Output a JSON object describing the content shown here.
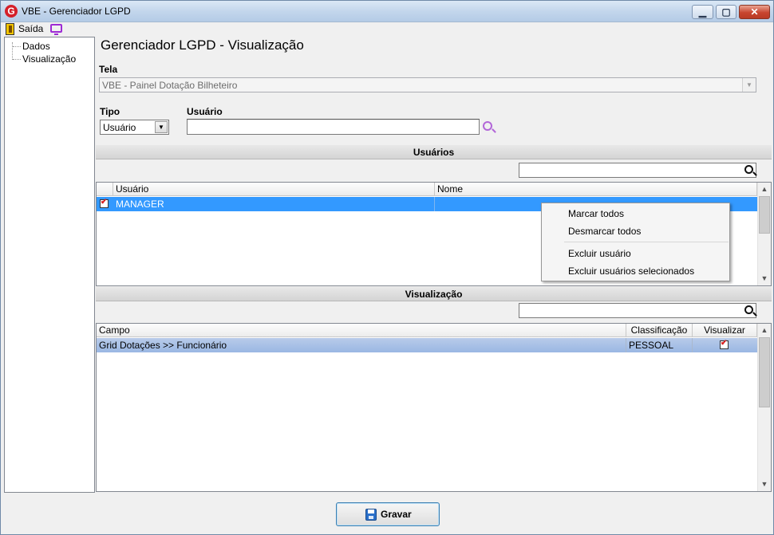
{
  "window": {
    "title": "VBE - Gerenciador LGPD",
    "app_icon": "G",
    "min_glyph": "▁",
    "max_glyph": "▢",
    "close_glyph": "✕"
  },
  "menu": {
    "exit_label": "Saída"
  },
  "tree": {
    "items": [
      {
        "label": "Dados"
      },
      {
        "label": "Visualização"
      }
    ]
  },
  "page": {
    "title": "Gerenciador LGPD - Visualização"
  },
  "form": {
    "tela_label": "Tela",
    "tela_value": "VBE - Painel Dotação Bilheteiro",
    "tipo_label": "Tipo",
    "tipo_value": "Usuário",
    "usuario_label": "Usuário",
    "usuario_value": ""
  },
  "arrows": {
    "down": "▼",
    "up": "▲"
  },
  "users_section": {
    "title": "Usuários",
    "filter_value": "",
    "columns": [
      "Usuário",
      "Nome"
    ],
    "rows": [
      {
        "checked": true,
        "usuario": "MANAGER",
        "nome": ""
      }
    ]
  },
  "context_menu": {
    "items": [
      "Marcar todos",
      "Desmarcar todos",
      "Excluir usuário",
      "Excluir usuários selecionados"
    ]
  },
  "view_section": {
    "title": "Visualização",
    "filter_value": "",
    "columns": [
      "Campo",
      "Classificação",
      "Visualizar"
    ],
    "rows": [
      {
        "campo": "Grid Dotações >> Funcionário",
        "classificacao": "PESSOAL",
        "visualizar": true
      }
    ]
  },
  "footer": {
    "save_label": "Gravar"
  },
  "colors": {
    "selection": "#3399ff",
    "accent_purple": "#9d2ad4",
    "check_red": "#d81e1e"
  }
}
